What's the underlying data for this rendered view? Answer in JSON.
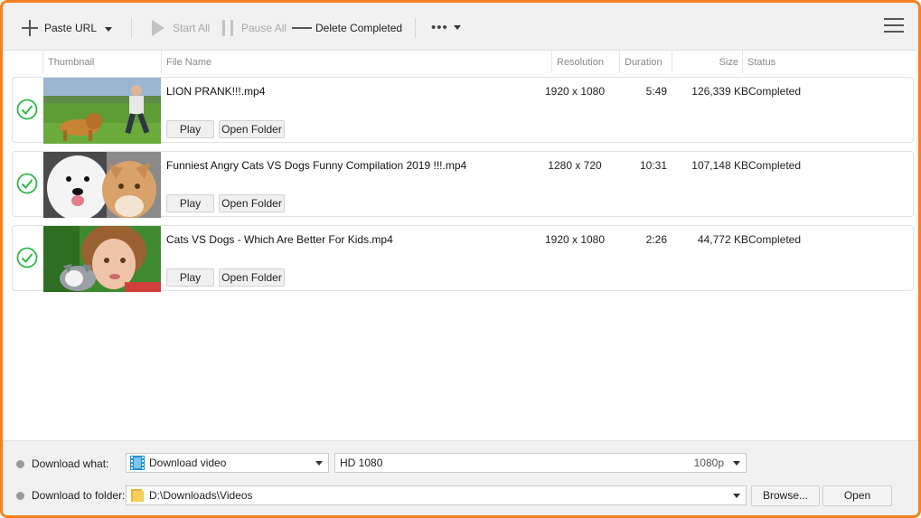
{
  "toolbar": {
    "paste_url": "Paste URL",
    "start_all": "Start All",
    "pause_all": "Pause All",
    "delete_completed": "Delete Completed",
    "more": "•••"
  },
  "columns": {
    "thumbnail": "Thumbnail",
    "file_name": "File Name",
    "resolution": "Resolution",
    "duration": "Duration",
    "size": "Size",
    "status": "Status"
  },
  "items": [
    {
      "file_name": "LION PRANK!!!.mp4",
      "resolution": "1920 x 1080",
      "duration": "5:49",
      "size": "126,339 KB",
      "status": "Completed",
      "play": "Play",
      "open_folder": "Open Folder"
    },
    {
      "file_name": "Funniest Angry Cats VS Dogs Funny Compilation 2019 !!!.mp4",
      "resolution": "1280 x 720",
      "duration": "10:31",
      "size": "107,148 KB",
      "status": "Completed",
      "play": "Play",
      "open_folder": "Open Folder"
    },
    {
      "file_name": "Cats VS Dogs - Which Are Better For Kids.mp4",
      "resolution": "1920 x 1080",
      "duration": "2:26",
      "size": "44,772 KB",
      "status": "Completed",
      "play": "Play",
      "open_folder": "Open Folder"
    }
  ],
  "bottom": {
    "download_what_label": "Download what:",
    "download_what_value": "Download video",
    "quality_value": "HD 1080",
    "quality_tag": "1080p",
    "download_folder_label": "Download to folder:",
    "folder_path": "D:\\Downloads\\Videos",
    "browse": "Browse...",
    "open": "Open"
  },
  "colors": {
    "window_border": "#f58220",
    "check_green": "#2db84a",
    "check_stroke": "#27a844"
  }
}
